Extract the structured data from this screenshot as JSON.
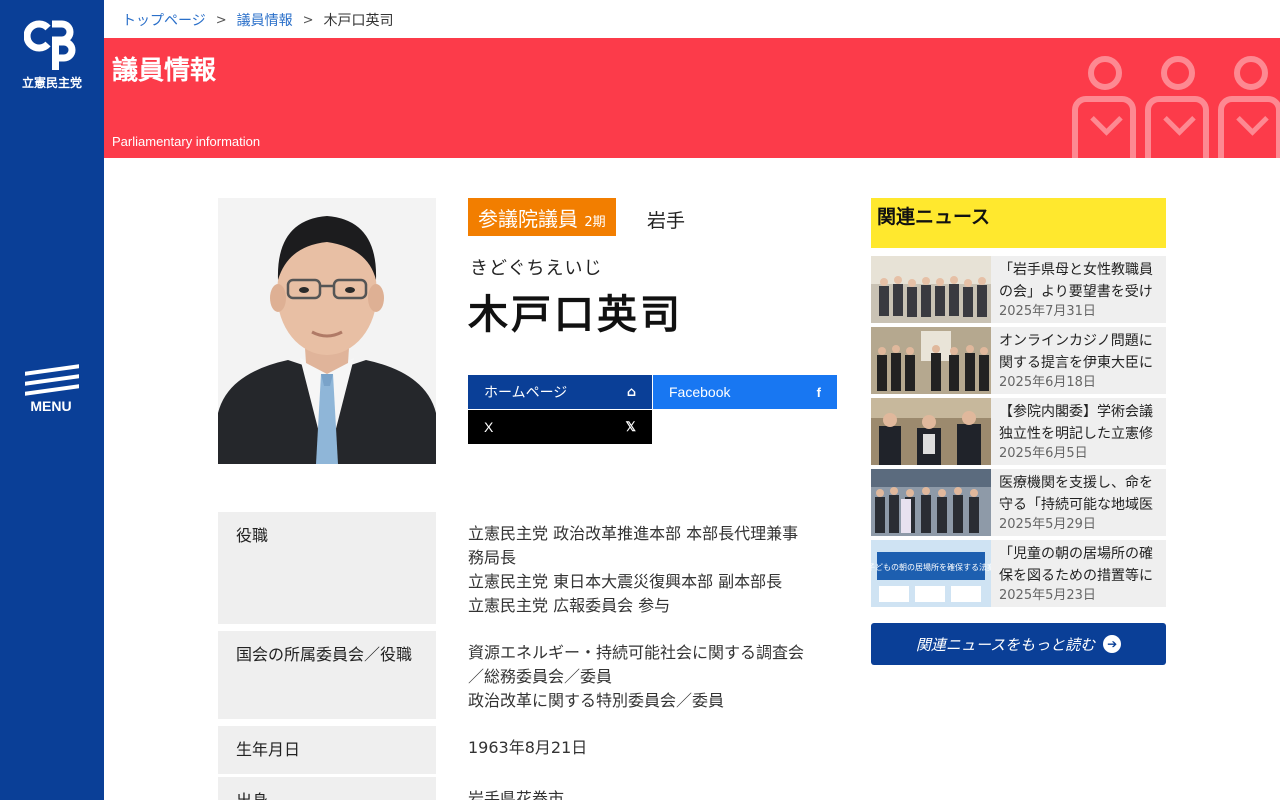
{
  "sidebar": {
    "logo_text": "立憲民主党",
    "menu_label": "MENU"
  },
  "breadcrumb": {
    "items": [
      "トップページ",
      "議員情報"
    ],
    "current": "木戸口英司"
  },
  "banner": {
    "title": "議員情報",
    "subtitle": "Parliamentary information"
  },
  "profile": {
    "title_badge": "参議院議員",
    "term": "2期",
    "prefecture": "岩手",
    "kana": "きどぐちえいじ",
    "name": "木戸口英司",
    "links": {
      "homepage": "ホームページ",
      "facebook": "Facebook",
      "x": "X"
    },
    "info": {
      "role_label": "役職",
      "role_lines": [
        "立憲民主党 政治改革推進本部 本部長代理兼事務局長",
        "立憲民主党 東日本大震災復興本部 副本部長",
        "立憲民主党 広報委員会 参与"
      ],
      "committee_label": "国会の所属委員会／役職",
      "committee_lines": [
        "資源エネルギー・持続可能社会に関する調査会／総務委員会／委員",
        "政治改革に関する特別委員会／委員"
      ],
      "birthday_label": "生年月日",
      "birthday": "1963年8月21日",
      "hometown_label": "出身",
      "hometown": "岩手県花巻市"
    }
  },
  "news": {
    "heading": "関連ニュース",
    "items": [
      {
        "title": "「岩手県母と女性教職員の会」より要望書を受け",
        "date": "2025年7月31日"
      },
      {
        "title": "オンラインカジノ問題に関する提言を伊東大臣に",
        "date": "2025年6月18日"
      },
      {
        "title": "【参院内閣委】学術会議独立性を明記した立憲修正",
        "date": "2025年6月5日"
      },
      {
        "title": "医療機関を支援し、命を守る「持続可能な地域医",
        "date": "2025年5月29日"
      },
      {
        "title": "「児童の朝の居場所の確保を図るための措置等に",
        "date": "2025年5月23日"
      }
    ],
    "thumb_banner_text": "子どもの朝の居場所を確保する法案",
    "more_label": "関連ニュースをもっと読む"
  },
  "colors": {
    "sidebar": "#0a3f97",
    "banner": "#fc3b4a",
    "badge": "#f27e00",
    "news_heading": "#ffe82e",
    "facebook": "#1877f2"
  }
}
